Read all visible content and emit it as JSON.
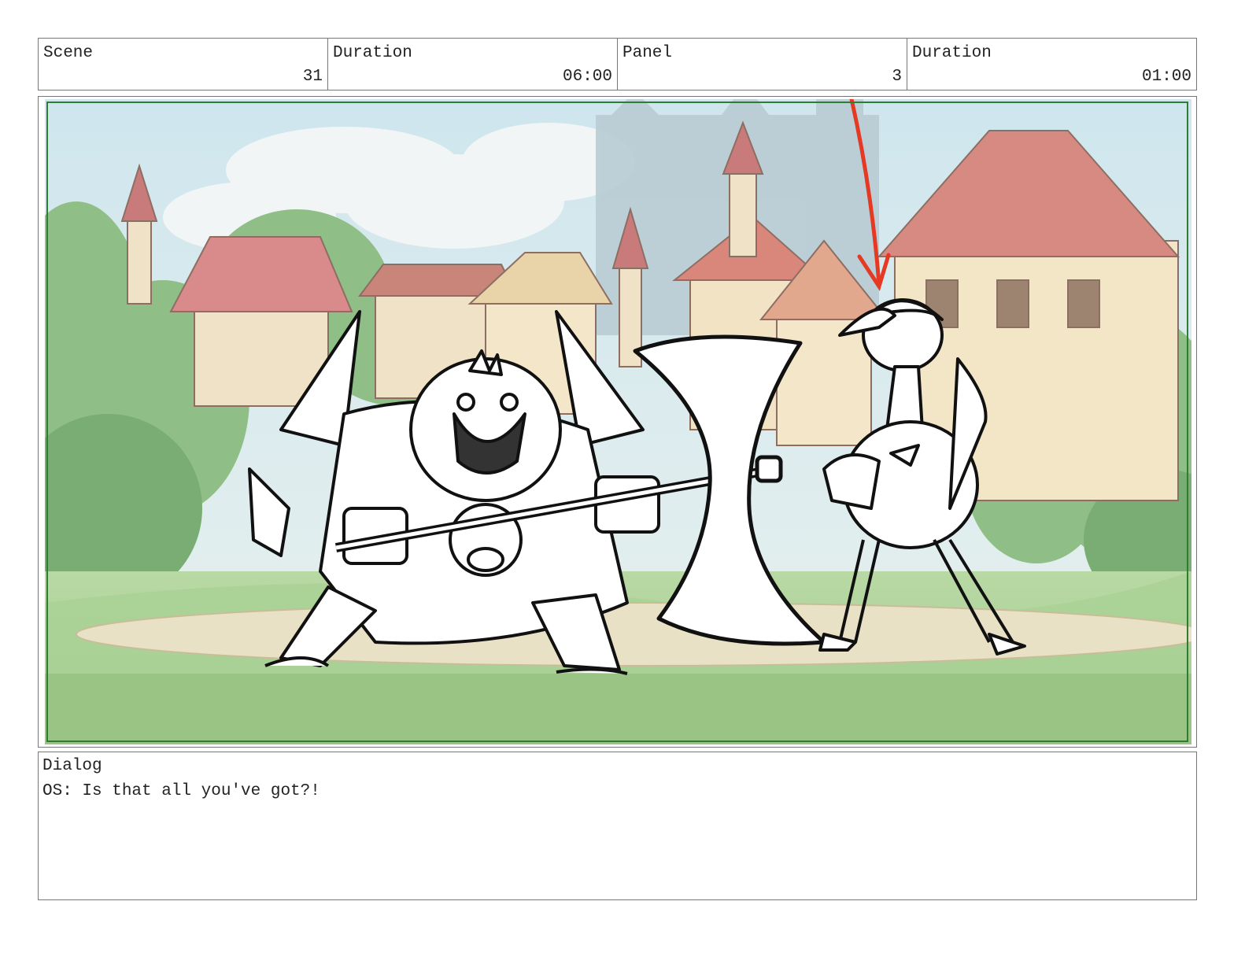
{
  "header": {
    "scene_label": "Scene",
    "scene_value": "31",
    "scene_duration_label": "Duration",
    "scene_duration_value": "06:00",
    "panel_label": "Panel",
    "panel_value": "3",
    "panel_duration_label": "Duration",
    "panel_duration_value": "01:00"
  },
  "panel": {
    "safe_area_color": "#2e7d32",
    "arrow_color": "#e53924"
  },
  "dialog": {
    "label": "Dialog",
    "text": "OS: Is that all you've got?!"
  }
}
